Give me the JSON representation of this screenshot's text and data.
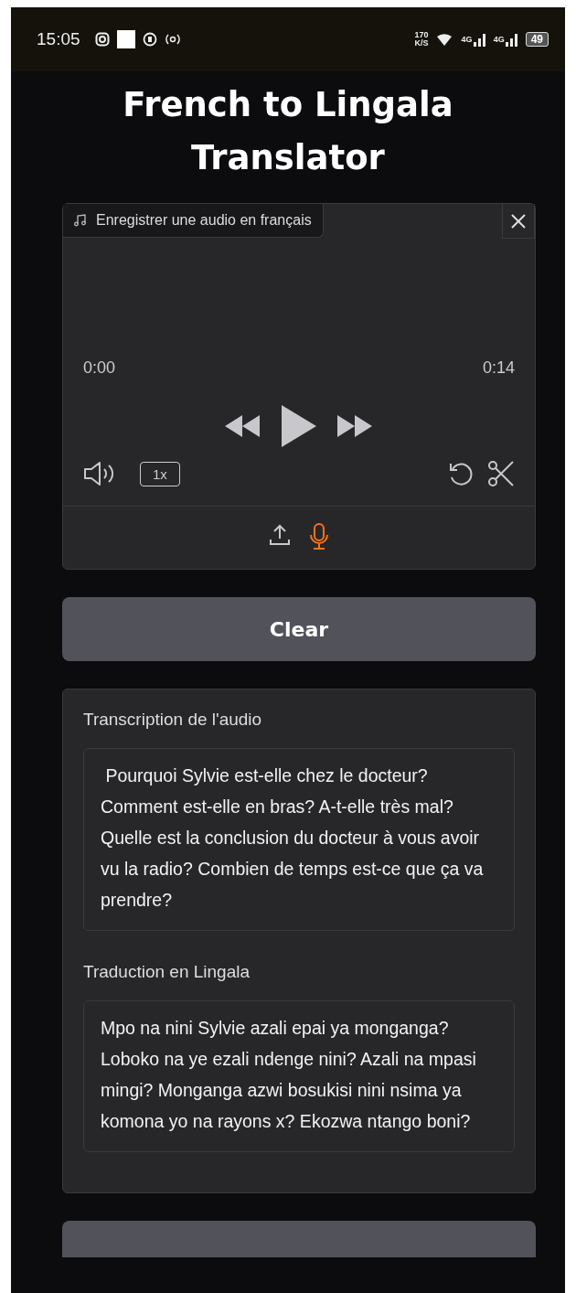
{
  "status_bar": {
    "time": "15:05",
    "speed": "170",
    "speed_unit": "K/S",
    "networks": [
      "4G",
      "4G"
    ],
    "battery": "49"
  },
  "title": "French to Lingala Translator",
  "audio": {
    "label": "Enregistrer une audio en français",
    "current_time": "0:00",
    "duration": "0:14",
    "speed": "1x",
    "sources": [
      {
        "kind": "upload",
        "selected": false
      },
      {
        "kind": "microphone",
        "selected": true
      }
    ]
  },
  "clear_button": "Clear",
  "outputs": [
    {
      "label": "Transcription de l'audio",
      "value": " Pourquoi Sylvie est-elle chez le docteur? Comment est-elle en bras? A-t-elle très mal? Quelle est la conclusion du docteur à vous avoir vu la radio? Combien de temps est-ce que ça va prendre?"
    },
    {
      "label": "Traduction en Lingala",
      "value": "Mpo na nini Sylvie azali epai ya monganga? Loboko na ye ezali ndenge nini? Azali na mpasi mingi? Monganga azwi bosukisi nini nsima ya komona yo na rayons x? Ekozwa ntango boni?"
    }
  ]
}
